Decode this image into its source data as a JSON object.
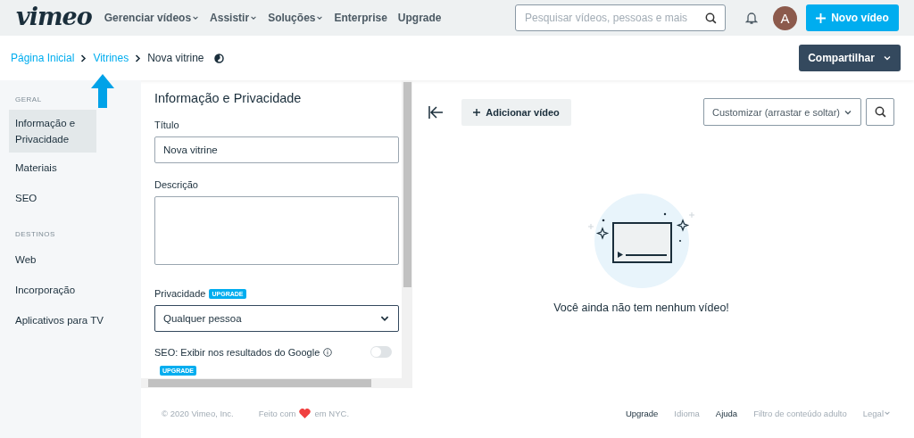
{
  "header": {
    "logo": "vimeo",
    "nav": [
      {
        "label": "Gerenciar vídeos",
        "dropdown": true
      },
      {
        "label": "Assistir",
        "dropdown": true
      },
      {
        "label": "Soluções",
        "dropdown": true
      },
      {
        "label": "Enterprise",
        "dropdown": false
      },
      {
        "label": "Upgrade",
        "dropdown": false
      }
    ],
    "search": {
      "placeholder": "Pesquisar vídeos, pessoas e mais"
    },
    "avatar": "A",
    "new_video": "Novo vídeo"
  },
  "breadcrumbs": [
    {
      "label": "Página Inicial",
      "link": true
    },
    {
      "label": "Vitrines",
      "link": true
    },
    {
      "label": "Nova vitrine",
      "link": false
    }
  ],
  "share_button": "Compartilhar",
  "sidebar": [
    {
      "heading": "GERAL",
      "items": [
        {
          "label": "Informação e Privacidade",
          "selected": true
        },
        {
          "label": "Materiais",
          "selected": false
        },
        {
          "label": "SEO",
          "selected": false
        }
      ]
    },
    {
      "heading": "DESTINOS",
      "items": [
        {
          "label": "Web",
          "selected": false
        },
        {
          "label": "Incorporação",
          "selected": false
        },
        {
          "label": "Aplicativos para TV",
          "selected": false
        }
      ]
    }
  ],
  "form": {
    "title": "Informação e Privacidade",
    "title_label": "Título",
    "title_value": "Nova vitrine",
    "description_label": "Descrição",
    "privacy_label": "Privacidade",
    "privacy_badge": "UPGRADE",
    "privacy_value": "Qualquer pessoa",
    "seo_label": "SEO: Exibir nos resultados do Google",
    "seo_on": false,
    "seo_badge": "UPGRADE"
  },
  "toolbar": {
    "add_video": "Adicionar vídeo",
    "sort": "Customizar (arrastar e soltar)"
  },
  "empty_message": "Você ainda não tem nenhum vídeo!",
  "footer": {
    "copyright": "© 2020 Vimeo, Inc.",
    "made_with": "Feito com",
    "made_in": "em NYC.",
    "links": [
      {
        "label": "Upgrade",
        "muted": false,
        "dropdown": false
      },
      {
        "label": "Idioma",
        "muted": true,
        "dropdown": false
      },
      {
        "label": "Ajuda",
        "muted": false,
        "dropdown": false
      },
      {
        "label": "Filtro de conteúdo adulto",
        "muted": true,
        "dropdown": false
      },
      {
        "label": "Legal",
        "muted": true,
        "dropdown": true
      }
    ]
  }
}
